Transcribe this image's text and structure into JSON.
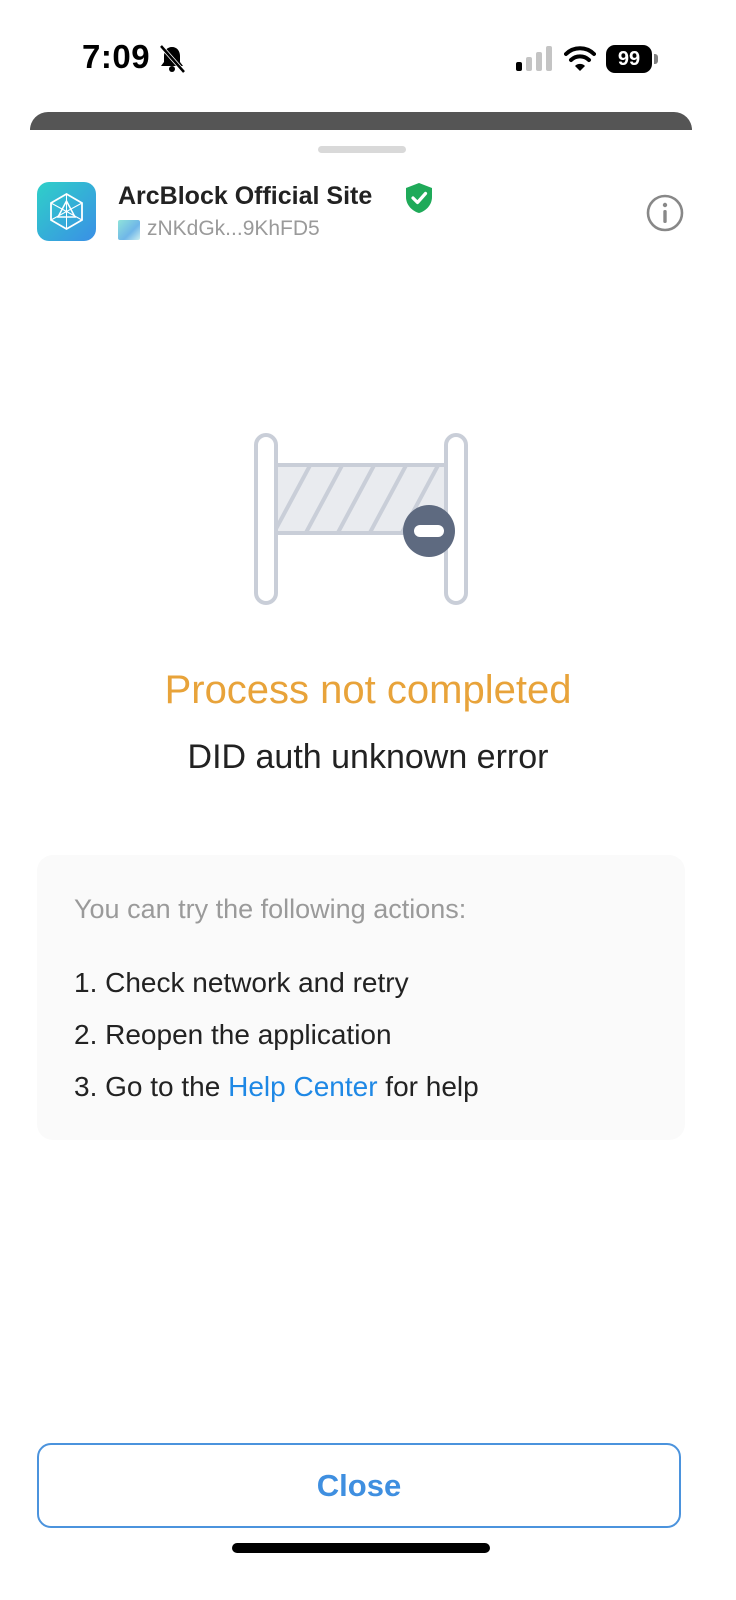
{
  "status_bar": {
    "time": "7:09",
    "battery": "99",
    "icons": [
      "bell-slash-icon",
      "signal-icon",
      "wifi-icon",
      "battery-icon"
    ]
  },
  "app": {
    "name": "ArcBlock Official Site",
    "did": "zNKdGk...9KhFD5",
    "verified": true,
    "icons": [
      "arcblock-logo-icon",
      "verified-shield-icon",
      "info-icon"
    ]
  },
  "error": {
    "illustration": "barrier-icon",
    "title": "Process not completed",
    "message": "DID auth unknown error"
  },
  "actions": {
    "heading": "You can try the following actions:",
    "items": [
      {
        "text": "1. Check network and retry"
      },
      {
        "text": "2. Reopen the application"
      },
      {
        "prefix": "3. Go to the ",
        "link": "Help Center",
        "suffix": " for help"
      }
    ]
  },
  "footer": {
    "close_label": "Close"
  },
  "colors": {
    "title": "#e8a33a",
    "link": "#1e88e5",
    "button_border": "#4b93dd",
    "verified": "#1faa59"
  }
}
